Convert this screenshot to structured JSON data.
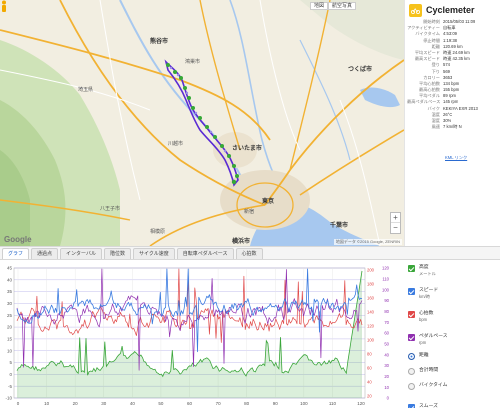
{
  "map": {
    "controls": [
      "地図",
      "航空写真"
    ],
    "google": "Google",
    "attribution": "地図データ ©2015 Google, ZENRIN",
    "places": [
      {
        "name": "熊谷市",
        "type": "city"
      },
      {
        "name": "鴻巣市",
        "type": "town"
      },
      {
        "name": "つくば市",
        "type": "city"
      },
      {
        "name": "埼玉県",
        "type": "region"
      },
      {
        "name": "さいたま市",
        "type": "city"
      },
      {
        "name": "川越市",
        "type": "town"
      },
      {
        "name": "東京",
        "type": "city"
      },
      {
        "name": "新宿",
        "type": "town"
      },
      {
        "name": "横浜市",
        "type": "city"
      },
      {
        "name": "千葉市",
        "type": "city"
      },
      {
        "name": "八王子市",
        "type": "town"
      },
      {
        "name": "相模原",
        "type": "town"
      }
    ]
  },
  "info": {
    "app_name": "Cyclemeter",
    "rows": [
      {
        "k": "開始時刻",
        "v": "2015/05/03 11:09"
      },
      {
        "k": "アクティビティー",
        "v": "自転車"
      },
      {
        "k": "バイクタイム",
        "v": "4:53:09"
      },
      {
        "k": "停止時間",
        "v": "1:19:38"
      },
      {
        "k": "距離",
        "v": "120.69 km"
      },
      {
        "k": "平均スピード",
        "v": "時速 24.69 km"
      },
      {
        "k": "最高スピード",
        "v": "時速 42.35 km"
      },
      {
        "k": "登り",
        "v": "574"
      },
      {
        "k": "下り",
        "v": "569"
      },
      {
        "k": "カロリー",
        "v": "3653"
      },
      {
        "k": "平均心拍数",
        "v": "134 bpm"
      },
      {
        "k": "最高心拍数",
        "v": "155 bpm"
      },
      {
        "k": "平均ペダル",
        "v": "89 rpm"
      },
      {
        "k": "最高ペダルペース",
        "v": "145 rpm"
      },
      {
        "k": "バイク",
        "v": "KEKIYA EXR 2013"
      },
      {
        "k": "温度",
        "v": "26°C"
      },
      {
        "k": "湿度",
        "v": "30%"
      },
      {
        "k": "風速",
        "v": "7 km/時 N"
      }
    ],
    "kml_link": "KML リンク"
  },
  "tabs": [
    "グラフ",
    "通過点",
    "インターバル",
    "階位数",
    "サイクル速度",
    "自転車ペダルペース",
    "心拍数"
  ],
  "legend": {
    "checks": [
      {
        "label": "高度",
        "sub": "メートル",
        "color": "#3aa63a"
      },
      {
        "label": "スピード",
        "sub": "km/時",
        "color": "#3a7be0"
      },
      {
        "label": "心拍数",
        "sub": "bpm",
        "color": "#e04848"
      },
      {
        "label": "ペダルペース",
        "sub": "rpm",
        "color": "#9030b0"
      }
    ],
    "radios": [
      {
        "label": "距離",
        "on": true
      },
      {
        "label": "合計時間",
        "on": false
      },
      {
        "label": "バイクタイム",
        "on": false
      }
    ],
    "smooth": {
      "label": "スムーズ",
      "color": "#3a7be0"
    }
  },
  "chart_data": {
    "type": "line",
    "x_ticks": [
      "0",
      "10",
      "20",
      "30",
      "40",
      "50",
      "60",
      "70",
      "80",
      "90",
      "100",
      "110",
      "120"
    ],
    "y_left_ticks": [
      "45",
      "40",
      "35",
      "30",
      "25",
      "20",
      "15",
      "10",
      "5",
      "0",
      "-5",
      "-10"
    ],
    "y_right1_ticks": [
      "200",
      "180",
      "160",
      "140",
      "120",
      "100",
      "80",
      "60",
      "40",
      "20"
    ],
    "y_right2_ticks": [
      "120",
      "110",
      "100",
      "90",
      "80",
      "70",
      "60",
      "50",
      "40",
      "30",
      "20",
      "10",
      "0"
    ],
    "xlim": [
      0,
      122
    ],
    "ylim": [
      -10,
      45
    ],
    "series": [
      {
        "name": "高度",
        "color": "#3aa63a"
      },
      {
        "name": "スピード",
        "color": "#3a7be0"
      },
      {
        "name": "心拍数",
        "color": "#e04848"
      },
      {
        "name": "ペダルペース",
        "color": "#9030b0"
      }
    ]
  }
}
